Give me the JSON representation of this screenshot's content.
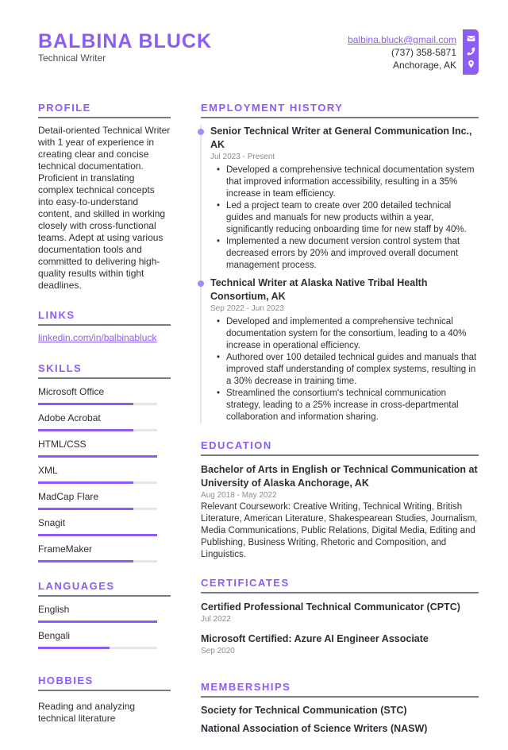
{
  "header": {
    "name": "BALBINA BLUCK",
    "title": "Technical Writer",
    "email": "balbina.bluck@gmail.com",
    "phone": "(737) 358-5871",
    "location": "Anchorage, AK"
  },
  "accent_color": "#8b5cf6",
  "profile": {
    "heading": "PROFILE",
    "text": "Detail-oriented Technical Writer with 1 year of experience in creating clear and concise technical documentation. Proficient in translating complex technical concepts into easy-to-understand content, and skilled in working closely with cross-functional teams. Adept at using various documentation tools and committed to delivering high-quality results within tight deadlines."
  },
  "links": {
    "heading": "LINKS",
    "items": [
      "linkedin.com/in/balbinabluck"
    ]
  },
  "skills": {
    "heading": "SKILLS",
    "items": [
      {
        "name": "Microsoft Office",
        "level": 0.8
      },
      {
        "name": "Adobe Acrobat",
        "level": 0.8
      },
      {
        "name": "HTML/CSS",
        "level": 1.0
      },
      {
        "name": "XML",
        "level": 0.8
      },
      {
        "name": "MadCap Flare",
        "level": 0.8
      },
      {
        "name": "Snagit",
        "level": 1.0
      },
      {
        "name": "FrameMaker",
        "level": 0.8
      }
    ]
  },
  "languages": {
    "heading": "LANGUAGES",
    "items": [
      {
        "name": "English",
        "level": 1.0
      },
      {
        "name": "Bengali",
        "level": 0.6
      }
    ]
  },
  "hobbies": {
    "heading": "HOBBIES",
    "text": "Reading and analyzing technical literature"
  },
  "employment": {
    "heading": "EMPLOYMENT HISTORY",
    "jobs": [
      {
        "title": "Senior Technical Writer at General Communication Inc., AK",
        "date": "Jul 2023 - Present",
        "bullets": [
          "Developed a comprehensive technical documentation system that improved information accessibility, resulting in a 35% increase in team efficiency.",
          "Led a project team to create over 200 detailed technical guides and manuals for new products within a year, significantly reducing onboarding time for new staff by 40%.",
          "Implemented a new document version control system that decreased errors by 20% and improved overall document management process."
        ]
      },
      {
        "title": "Technical Writer at Alaska Native Tribal Health Consortium, AK",
        "date": "Sep 2022 - Jun 2023",
        "bullets": [
          "Developed and implemented a comprehensive technical documentation system for the consortium, leading to a 40% increase in operational efficiency.",
          "Authored over 100 detailed technical guides and manuals that improved staff understanding of complex systems, resulting in a 30% decrease in training time.",
          "Streamlined the consortium's technical communication strategy, leading to a 25% increase in cross-departmental collaboration and information sharing."
        ]
      }
    ]
  },
  "education": {
    "heading": "EDUCATION",
    "degree": "Bachelor of Arts in English or Technical Communication at University of Alaska Anchorage, AK",
    "date": "Aug 2018 - May 2022",
    "coursework": "Relevant Coursework: Creative Writing, Technical Writing, British Literature, American Literature, Shakespearean Studies, Journalism, Media Communications, Public Relations, Digital Media, Editing and Publishing, Business Writing, Rhetoric and Composition, and Linguistics."
  },
  "certificates": {
    "heading": "CERTIFICATES",
    "items": [
      {
        "name": "Certified Professional Technical Communicator (CPTC)",
        "date": "Jul 2022"
      },
      {
        "name": "Microsoft Certified: Azure AI Engineer Associate",
        "date": "Sep 2020"
      }
    ]
  },
  "memberships": {
    "heading": "MEMBERSHIPS",
    "items": [
      "Society for Technical Communication (STC)",
      "National Association of Science Writers (NASW)"
    ]
  }
}
